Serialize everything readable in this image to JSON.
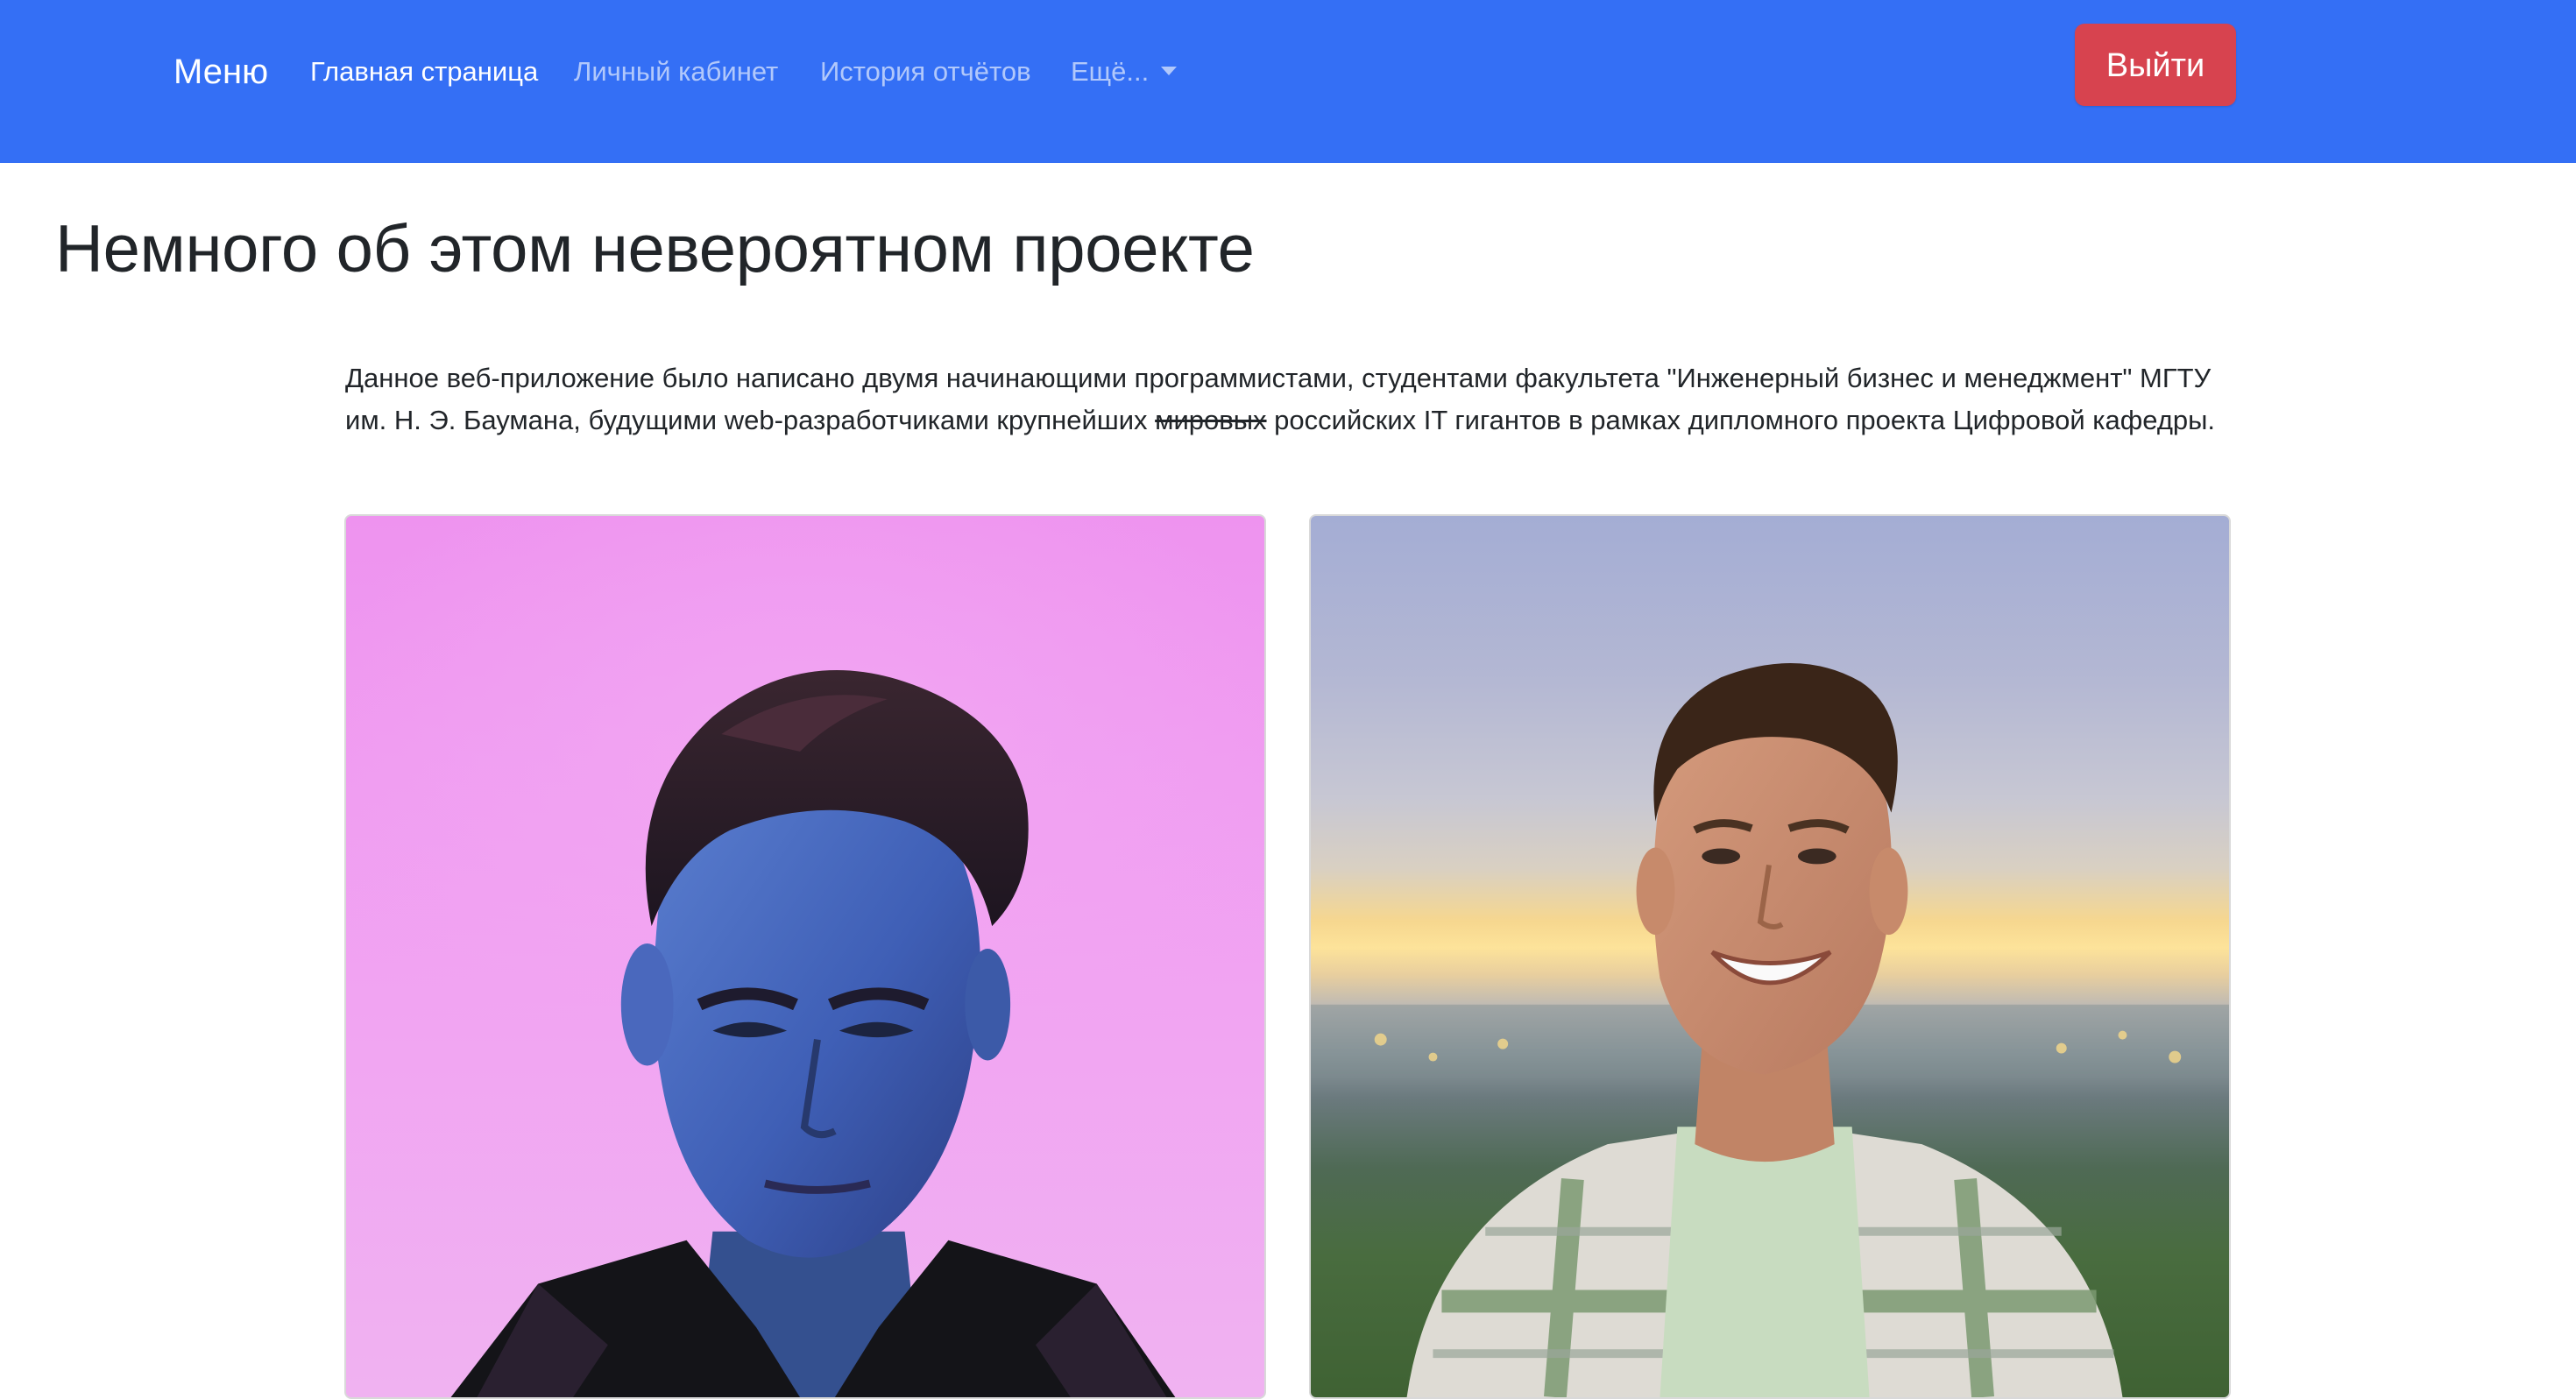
{
  "colors": {
    "navbar": "#346ff5",
    "logout_button": "#d7434f"
  },
  "navbar": {
    "brand": "Меню",
    "links": [
      {
        "label": "Главная страница",
        "active": true
      },
      {
        "label": "Личный кабинет",
        "active": false
      },
      {
        "label": "История отчётов",
        "active": false
      }
    ],
    "more_label": "Ещё...",
    "more_icon": "chevron-down-icon",
    "logout_label": "Выйти"
  },
  "main": {
    "title": "Немного об этом невероятном проекте",
    "intro_before": "Данное веб-приложение было написано двумя начинающими программистами, студентами факультета \"Инженерный бизнес и менеджмент\" МГТУ им. Н. Э. Баумана, будущими web-разработчиками крупнейших ",
    "intro_struck": "мировых",
    "intro_after": " российских IT гигантов в рамках дипломного проекта Цифровой кафедры."
  }
}
